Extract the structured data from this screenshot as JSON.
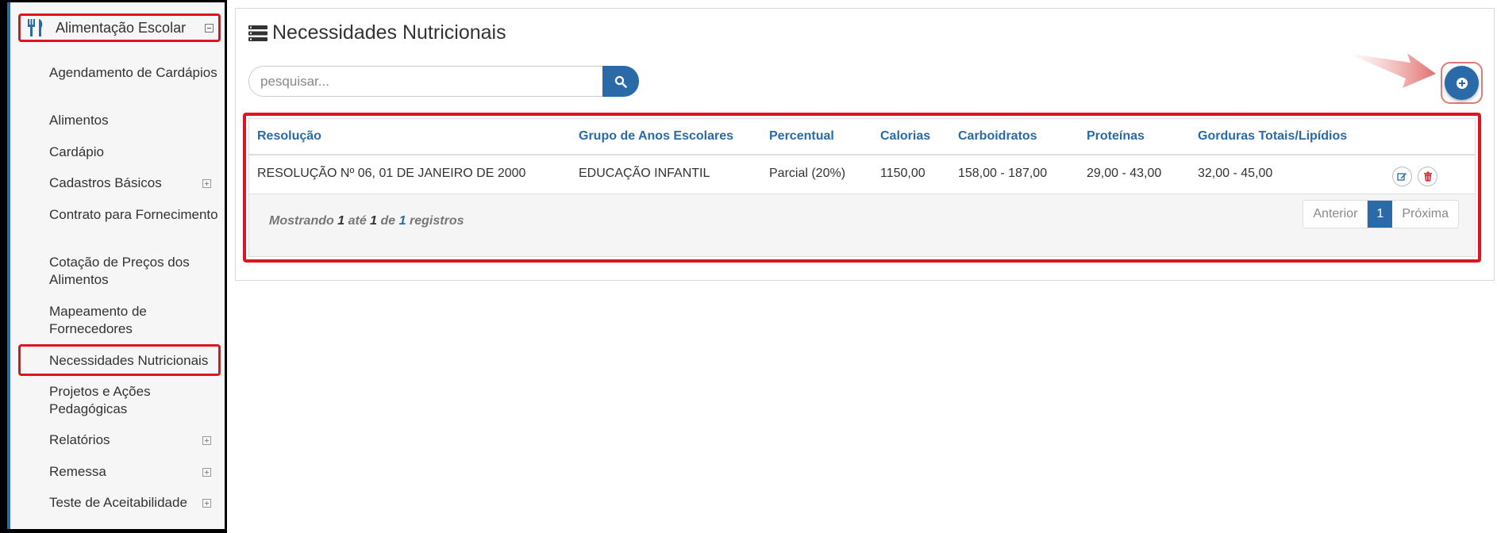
{
  "sidebar": {
    "header_label": "Alimentação Escolar",
    "items": [
      {
        "label": "Agendamento de Cardápios"
      },
      {
        "label": "Alimentos"
      },
      {
        "label": "Cardápio"
      },
      {
        "label": "Cadastros Básicos"
      },
      {
        "label": "Contrato para Fornecimento"
      },
      {
        "label": "Cotação de Preços dos Alimentos"
      },
      {
        "label": "Mapeamento de Fornecedores"
      },
      {
        "label": "Necessidades Nutricionais"
      },
      {
        "label": "Projetos e Ações Pedagógicas"
      },
      {
        "label": "Relatórios"
      },
      {
        "label": "Remessa"
      },
      {
        "label": "Teste de Aceitabilidade"
      }
    ]
  },
  "main": {
    "title": "Necessidades Nutricionais",
    "search_placeholder": "pesquisar..."
  },
  "table": {
    "headers": [
      "Resolução",
      "Grupo de Anos Escolares",
      "Percentual",
      "Calorias",
      "Carboidratos",
      "Proteínas",
      "Gorduras Totais/Lipídios"
    ],
    "rows": [
      [
        "RESOLUÇÃO Nº 06, 01 DE JANEIRO DE 2000",
        "EDUCAÇÃO INFANTIL",
        "Parcial (20%)",
        "1150,00",
        "158,00 - 187,00",
        "29,00 - 43,00",
        "32,00 - 45,00"
      ]
    ]
  },
  "footer": {
    "showing_prefix": "Mostrando",
    "from": "1",
    "ate": "até",
    "to": "1",
    "de": "de",
    "total": "1",
    "registros": "registros"
  },
  "pagination": {
    "prev": "Anterior",
    "current": "1",
    "next": "Próxima"
  },
  "colors": {
    "accent": "#2a6aa8",
    "highlight": "#e0141e"
  }
}
